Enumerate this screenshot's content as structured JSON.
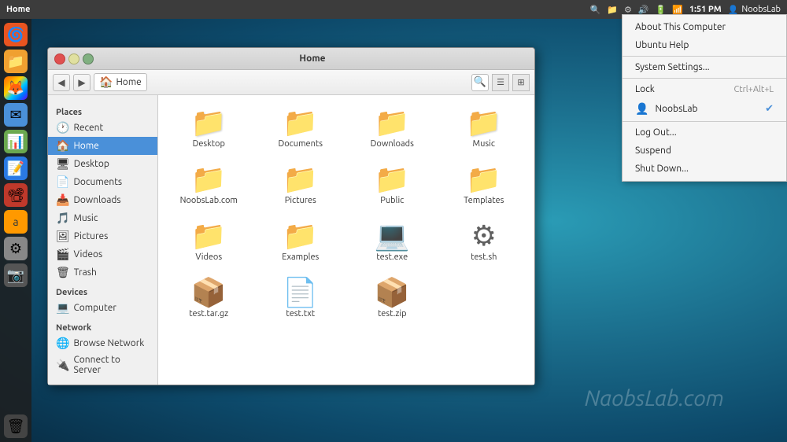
{
  "topPanel": {
    "title": "Home",
    "time": "1:51 PM",
    "userName": "NoobsLab",
    "icons": [
      "search",
      "files",
      "settings",
      "volume",
      "battery",
      "network"
    ]
  },
  "dock": {
    "icons": [
      {
        "name": "ubuntu-icon",
        "emoji": "🌀",
        "class": "dock-icon-ubuntu"
      },
      {
        "name": "files-icon",
        "emoji": "📁",
        "class": "dock-icon-files"
      },
      {
        "name": "firefox-icon",
        "emoji": "🦊",
        "class": "dock-icon-browser"
      },
      {
        "name": "email-icon",
        "emoji": "✉",
        "class": "dock-icon-email"
      },
      {
        "name": "spreadsheet-icon",
        "emoji": "📊",
        "class": "dock-icon-calc"
      },
      {
        "name": "writer-icon",
        "emoji": "📝",
        "class": "dock-icon-writer"
      },
      {
        "name": "impress-icon",
        "emoji": "📽",
        "class": "dock-icon-impress"
      },
      {
        "name": "amazon-icon",
        "emoji": "🛒",
        "class": "dock-icon-amazon"
      },
      {
        "name": "system-settings-icon",
        "emoji": "⚙",
        "class": "dock-icon-settings"
      },
      {
        "name": "camera-icon",
        "emoji": "📷",
        "class": "dock-icon-camera"
      },
      {
        "name": "trash-dock-icon",
        "emoji": "🗑",
        "class": "dock-icon-trash"
      }
    ]
  },
  "fileManager": {
    "title": "Home",
    "breadcrumb": "Home",
    "sidebar": {
      "sections": [
        {
          "header": "Places",
          "items": [
            {
              "label": "Recent",
              "icon": "🕐",
              "active": false
            },
            {
              "label": "Home",
              "icon": "🏠",
              "active": true
            },
            {
              "label": "Desktop",
              "icon": "🖥",
              "active": false
            },
            {
              "label": "Documents",
              "icon": "📄",
              "active": false
            },
            {
              "label": "Downloads",
              "icon": "📥",
              "active": false
            },
            {
              "label": "Music",
              "icon": "🎵",
              "active": false
            },
            {
              "label": "Pictures",
              "icon": "🖼",
              "active": false
            },
            {
              "label": "Videos",
              "icon": "🎬",
              "active": false
            },
            {
              "label": "Trash",
              "icon": "🗑",
              "active": false
            }
          ]
        },
        {
          "header": "Devices",
          "items": [
            {
              "label": "Computer",
              "icon": "💻",
              "active": false
            }
          ]
        },
        {
          "header": "Network",
          "items": [
            {
              "label": "Browse Network",
              "icon": "🌐",
              "active": false
            },
            {
              "label": "Connect to Server",
              "icon": "🔌",
              "active": false
            }
          ]
        }
      ]
    },
    "files": [
      {
        "name": "Desktop",
        "icon": "📁",
        "type": "folder"
      },
      {
        "name": "Documents",
        "icon": "📁",
        "type": "folder"
      },
      {
        "name": "Downloads",
        "icon": "📁",
        "type": "folder-blue"
      },
      {
        "name": "Music",
        "icon": "📁",
        "type": "folder"
      },
      {
        "name": "NoobsLab.com",
        "icon": "📁",
        "type": "folder-special"
      },
      {
        "name": "Pictures",
        "icon": "📁",
        "type": "folder-special"
      },
      {
        "name": "Public",
        "icon": "📁",
        "type": "folder-special"
      },
      {
        "name": "Templates",
        "icon": "📁",
        "type": "folder-light"
      },
      {
        "name": "Videos",
        "icon": "📁",
        "type": "folder-blue"
      },
      {
        "name": "Examples",
        "icon": "📁",
        "type": "folder-special"
      },
      {
        "name": "test.exe",
        "icon": "💻",
        "type": "exec"
      },
      {
        "name": "test.sh",
        "icon": "⚙",
        "type": "script"
      },
      {
        "name": "test.tar.gz",
        "icon": "📦",
        "type": "archive"
      },
      {
        "name": "test.txt",
        "icon": "📄",
        "type": "text"
      },
      {
        "name": "test.zip",
        "icon": "📦",
        "type": "archive"
      }
    ]
  },
  "contextMenu": {
    "items": [
      {
        "label": "About This Computer",
        "type": "item",
        "shortcut": ""
      },
      {
        "label": "Ubuntu Help",
        "type": "item",
        "shortcut": ""
      },
      {
        "type": "separator"
      },
      {
        "label": "System Settings...",
        "type": "item",
        "shortcut": ""
      },
      {
        "type": "separator"
      },
      {
        "label": "Lock",
        "type": "item",
        "shortcut": "Ctrl+Alt+L"
      },
      {
        "label": "NoobsLab",
        "type": "user",
        "checked": true
      },
      {
        "type": "separator"
      },
      {
        "label": "Log Out...",
        "type": "item",
        "shortcut": ""
      },
      {
        "label": "Suspend",
        "type": "item",
        "shortcut": ""
      },
      {
        "label": "Shut Down...",
        "type": "item",
        "shortcut": ""
      }
    ]
  },
  "watermark": "NaobsLab.com"
}
